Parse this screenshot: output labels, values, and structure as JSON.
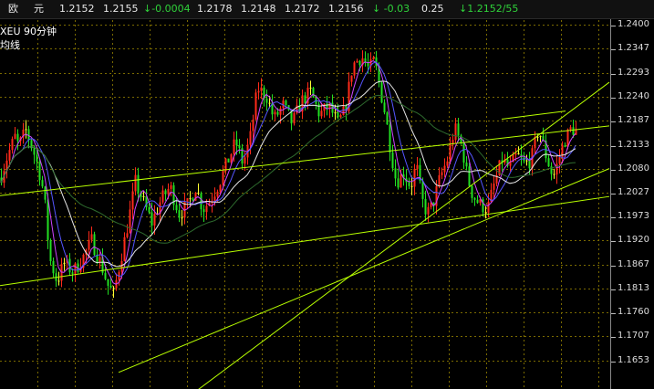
{
  "quote_bar": [
    {
      "text": "欧",
      "color": "white"
    },
    {
      "text": "元",
      "color": "white"
    },
    {
      "text": "1.2152",
      "color": "white"
    },
    {
      "text": "1.2155",
      "color": "white"
    },
    {
      "text": "↓-0.0004",
      "color": "green"
    },
    {
      "text": "1.2178",
      "color": "white"
    },
    {
      "text": "1.2148",
      "color": "white"
    },
    {
      "text": "1.2172",
      "color": "white"
    },
    {
      "text": "1.2156",
      "color": "white"
    },
    {
      "text": "↓ -0.03",
      "color": "green"
    },
    {
      "text": "0.25",
      "color": "white"
    },
    {
      "text": "↓1.2152/55",
      "color": "green"
    }
  ],
  "chart": {
    "symbol_title": "XEU   90分钟",
    "indicator_label": "均线"
  },
  "colors": {
    "up_candle": "#ff2a1a",
    "down_candle": "#22e022",
    "doji": "#ffff33",
    "ma_white": "#e6e6e6",
    "ma_blue": "#5555ff",
    "ma_purple": "#cc44ff",
    "ma_green": "#2e6b2e",
    "trendline": "#b8ff00",
    "grid": "#7a6a00"
  },
  "chart_data": {
    "type": "candlestick",
    "y_ticks": [
      "1.2400",
      "1.2347",
      "1.2293",
      "1.2240",
      "1.2187",
      "1.2133",
      "1.2080",
      "1.2027",
      "1.1973",
      "1.1920",
      "1.1867",
      "1.1813",
      "1.1760",
      "1.1707",
      "1.1653"
    ],
    "ylim": [
      1.16,
      1.2425
    ],
    "close_path": [
      [
        0,
        1.206
      ],
      [
        8,
        1.211
      ],
      [
        16,
        1.215
      ],
      [
        20,
        1.213
      ],
      [
        28,
        1.2165
      ],
      [
        36,
        1.212
      ],
      [
        42,
        1.208
      ],
      [
        48,
        1.202
      ],
      [
        54,
        1.188
      ],
      [
        62,
        1.183
      ],
      [
        70,
        1.187
      ],
      [
        80,
        1.185
      ],
      [
        90,
        1.188
      ],
      [
        100,
        1.192
      ],
      [
        110,
        1.187
      ],
      [
        118,
        1.182
      ],
      [
        124,
        1.18
      ],
      [
        132,
        1.188
      ],
      [
        140,
        1.196
      ],
      [
        148,
        1.205
      ],
      [
        158,
        1.2
      ],
      [
        166,
        1.196
      ],
      [
        176,
        1.201
      ],
      [
        186,
        1.204
      ],
      [
        196,
        1.198
      ],
      [
        206,
        1.2
      ],
      [
        214,
        1.204
      ],
      [
        222,
        1.199
      ],
      [
        230,
        1.201
      ],
      [
        240,
        1.205
      ],
      [
        250,
        1.21
      ],
      [
        258,
        1.214
      ],
      [
        266,
        1.209
      ],
      [
        274,
        1.215
      ],
      [
        282,
        1.226
      ],
      [
        292,
        1.224
      ],
      [
        300,
        1.219
      ],
      [
        310,
        1.222
      ],
      [
        320,
        1.218
      ],
      [
        330,
        1.223
      ],
      [
        340,
        1.225
      ],
      [
        350,
        1.22
      ],
      [
        360,
        1.222
      ],
      [
        370,
        1.218
      ],
      [
        378,
        1.221
      ],
      [
        386,
        1.231
      ],
      [
        396,
        1.233
      ],
      [
        404,
        1.23
      ],
      [
        410,
        1.232
      ],
      [
        416,
        1.226
      ],
      [
        422,
        1.22
      ],
      [
        428,
        1.212
      ],
      [
        434,
        1.205
      ],
      [
        442,
        1.207
      ],
      [
        450,
        1.204
      ],
      [
        456,
        1.209
      ],
      [
        462,
        1.201
      ],
      [
        468,
        1.198
      ],
      [
        474,
        1.2
      ],
      [
        482,
        1.206
      ],
      [
        490,
        1.21
      ],
      [
        498,
        1.217
      ],
      [
        506,
        1.213
      ],
      [
        512,
        1.206
      ],
      [
        518,
        1.202
      ],
      [
        526,
        1.2
      ],
      [
        534,
        1.199
      ],
      [
        542,
        1.205
      ],
      [
        550,
        1.21
      ],
      [
        558,
        1.208
      ],
      [
        566,
        1.211
      ],
      [
        574,
        1.209
      ],
      [
        582,
        1.21
      ],
      [
        590,
        1.217
      ],
      [
        598,
        1.211
      ],
      [
        606,
        1.206
      ],
      [
        612,
        1.21
      ],
      [
        618,
        1.214
      ],
      [
        626,
        1.217
      ],
      [
        634,
        1.216
      ],
      [
        640,
        1.215
      ]
    ]
  }
}
